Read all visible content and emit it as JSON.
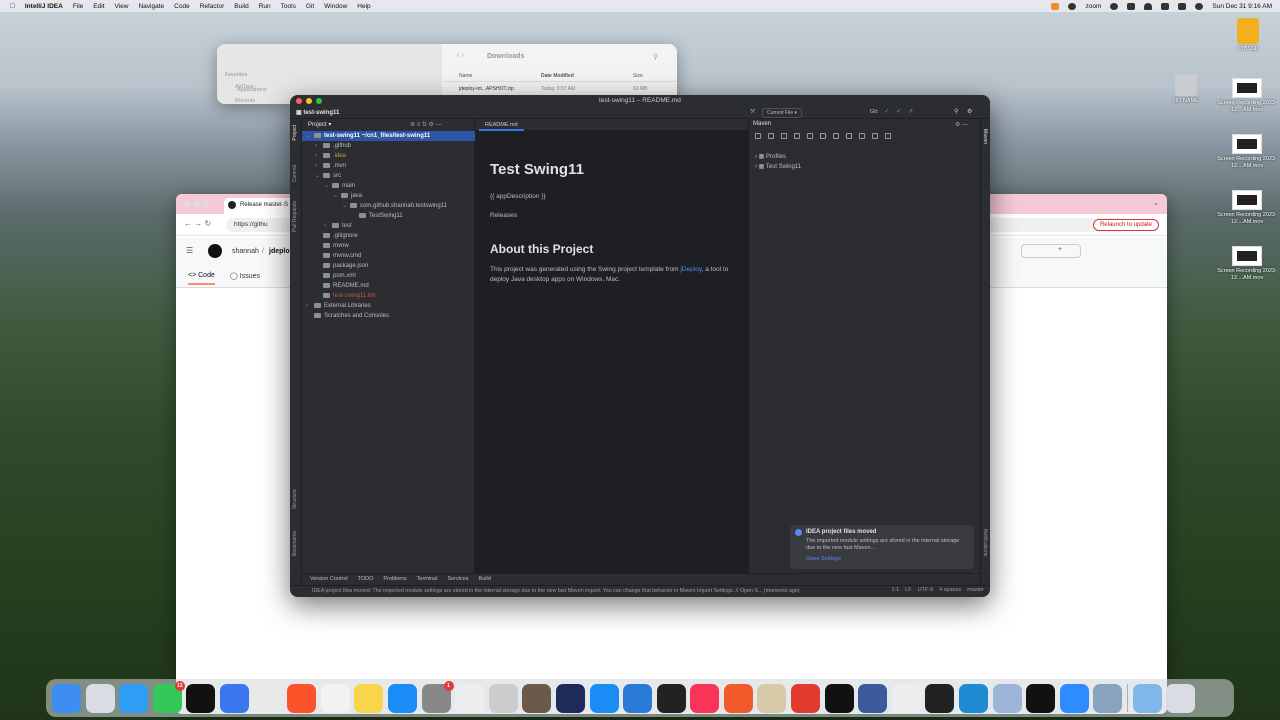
{
  "menubar": {
    "app": "IntelliJ IDEA",
    "items": [
      "File",
      "Edit",
      "View",
      "Navigate",
      "Code",
      "Refactor",
      "Build",
      "Run",
      "Tools",
      "Git",
      "Window",
      "Help"
    ],
    "zoom_label": "zoom",
    "clock": "Sun Dec 31  9:16 AM"
  },
  "desktop": {
    "icons": [
      {
        "label": "1TBSSD",
        "kind": "drive"
      },
      {
        "label": "NO NAME",
        "kind": "disk"
      },
      {
        "label": "Screen Recording 2023-12....AM.mov",
        "kind": "video"
      },
      {
        "label": "Screen Recording 2023-12....AM.mov",
        "kind": "video"
      },
      {
        "label": "Screen Recording 2023-12....AM.mov",
        "kind": "video"
      },
      {
        "label": "Screen Recording 2023-12....AM.mov",
        "kind": "video"
      }
    ]
  },
  "finder": {
    "title": "Downloads",
    "sidebar_sections": [
      "Favorites",
      "Locations"
    ],
    "sidebar": [
      "AirDrop",
      "Recents",
      "Applications",
      "Downloads",
      "Desktop",
      "iCloud Drive",
      "1TBSSD"
    ],
    "columns": [
      "Name",
      "Date Modified",
      "Size"
    ],
    "file": {
      "name": "jdeploy-int...APSHOT.zip",
      "date": "Today, 9:07 AM",
      "size": "63 MB"
    }
  },
  "chrome": {
    "tab_title": "Release master-S",
    "url": "https://githu",
    "relaunch": "Relaunch to update",
    "owner": "shannah",
    "repo": "jdeplo",
    "tabs": [
      "Code",
      "Issues"
    ]
  },
  "ide": {
    "window_title": "test-swing11 – README.md",
    "project_name": "test-swing11",
    "current_file": "Current File",
    "git_label": "Git:",
    "project_tool_label": "Project",
    "tree": [
      {
        "label": "test-swing11  ~/cn1_files/test-swing11",
        "depth": 0,
        "chev": "v",
        "sel": true
      },
      {
        "label": ".github",
        "depth": 1,
        "chev": ">"
      },
      {
        "label": ".idea",
        "depth": 1,
        "chev": ">",
        "color": "#c9a33e"
      },
      {
        "label": ".mvn",
        "depth": 1,
        "chev": ">"
      },
      {
        "label": "src",
        "depth": 1,
        "chev": "v"
      },
      {
        "label": "main",
        "depth": 2,
        "chev": "v"
      },
      {
        "label": "java",
        "depth": 3,
        "chev": "v"
      },
      {
        "label": "com.github.shannah.testswing11",
        "depth": 4,
        "chev": "v"
      },
      {
        "label": "TestSwing11",
        "depth": 5,
        "chev": ""
      },
      {
        "label": "test",
        "depth": 2,
        "chev": ">"
      },
      {
        "label": ".gitignore",
        "depth": 1,
        "chev": ""
      },
      {
        "label": "mvnw",
        "depth": 1,
        "chev": ""
      },
      {
        "label": "mvnw.cmd",
        "depth": 1,
        "chev": ""
      },
      {
        "label": "package.json",
        "depth": 1,
        "chev": ""
      },
      {
        "label": "pom.xml",
        "depth": 1,
        "chev": ""
      },
      {
        "label": "README.md",
        "depth": 1,
        "chev": ""
      },
      {
        "label": "test-swing11.iml",
        "depth": 1,
        "chev": "",
        "color": "#c75450"
      },
      {
        "label": "External Libraries",
        "depth": 0,
        "chev": ">"
      },
      {
        "label": "Scratches and Consoles",
        "depth": 0,
        "chev": ""
      }
    ],
    "editor_tab": "README.md",
    "readme": {
      "h1": "Test Swing11",
      "desc": "{{ appDescription }}",
      "releases": "Releases",
      "h2": "About this Project",
      "body_pre": "This project was generated using the Swing project template from ",
      "body_link": "jDeploy",
      "body_post": ", a tool to deploy Java desktop apps on Windows, Mac."
    },
    "maven": {
      "title": "Maven",
      "items": [
        "Profiles",
        "Test Swing11"
      ]
    },
    "notification": {
      "title": "IDEA project files moved",
      "body": "The imported module settings are stored in the internal storage due to the new fast Maven...",
      "action": "Open Settings"
    },
    "bottom_tabs": [
      "Version Control",
      "TODO",
      "Problems",
      "Terminal",
      "Services",
      "Build"
    ],
    "left_strip": [
      "Project",
      "Commit",
      "Pull Requests",
      "Structure",
      "Bookmarks"
    ],
    "right_strip": [
      "Maven",
      "Notifications"
    ],
    "status_message": "IDEA project files moved: The imported module settings are stored in the internal storage due to the new fast Maven import. You can change that behavior in Maven Import Settings. // Open S... (moments ago)",
    "status_right": [
      "1:1",
      "LF",
      "UTF-8",
      "4 spaces",
      "master"
    ]
  },
  "dock": {
    "apps": [
      {
        "name": "Finder",
        "color": "#3d8ef0"
      },
      {
        "name": "Launchpad",
        "color": "#d9dde3"
      },
      {
        "name": "Safari",
        "color": "#2f9df4"
      },
      {
        "name": "Messages",
        "color": "#35c759",
        "badge": "13"
      },
      {
        "name": "IntelliJ IDEA",
        "color": "#111"
      },
      {
        "name": "Signal",
        "color": "#3a76f0"
      },
      {
        "name": "Chrome",
        "color": "#e9e9e9"
      },
      {
        "name": "Brave",
        "color": "#fb542b"
      },
      {
        "name": "Photos",
        "color": "#f2f2f2"
      },
      {
        "name": "Notes",
        "color": "#f8d54a"
      },
      {
        "name": "App Store",
        "color": "#1a8cf5"
      },
      {
        "name": "System Settings",
        "color": "#888",
        "badge": "1"
      },
      {
        "name": "Vectorize",
        "color": "#eee"
      },
      {
        "name": "Scrivener",
        "color": "#ccc"
      },
      {
        "name": "Photo",
        "color": "#6b5a4a"
      },
      {
        "name": "Affinity",
        "color": "#1d2a5a"
      },
      {
        "name": "Xcode",
        "color": "#1a8cf5"
      },
      {
        "name": "Xcode Tools",
        "color": "#2a7bd8"
      },
      {
        "name": "Calendar",
        "color": "#222"
      },
      {
        "name": "Music",
        "color": "#fa3358"
      },
      {
        "name": "Pixelmator",
        "color": "#f25a2a"
      },
      {
        "name": "Garden",
        "color": "#d8c9a8"
      },
      {
        "name": "Remote Desktop",
        "color": "#e23a2e"
      },
      {
        "name": "Terminal",
        "color": "#111"
      },
      {
        "name": "Preview",
        "color": "#3a5a9a"
      },
      {
        "name": "TextEdit",
        "color": "#eee"
      },
      {
        "name": "Console",
        "color": "#222"
      },
      {
        "name": "VS Code",
        "color": "#1f8ad2"
      },
      {
        "name": "Migration",
        "color": "#9bb4d8"
      },
      {
        "name": "Apple TV",
        "color": "#111"
      },
      {
        "name": "Zoom",
        "color": "#2d8cff"
      },
      {
        "name": "QuickTime",
        "color": "#8aa4c0"
      },
      {
        "name": "Downloads",
        "color": "#7fb7e8"
      },
      {
        "name": "Trash",
        "color": "#d9dde3"
      }
    ]
  }
}
